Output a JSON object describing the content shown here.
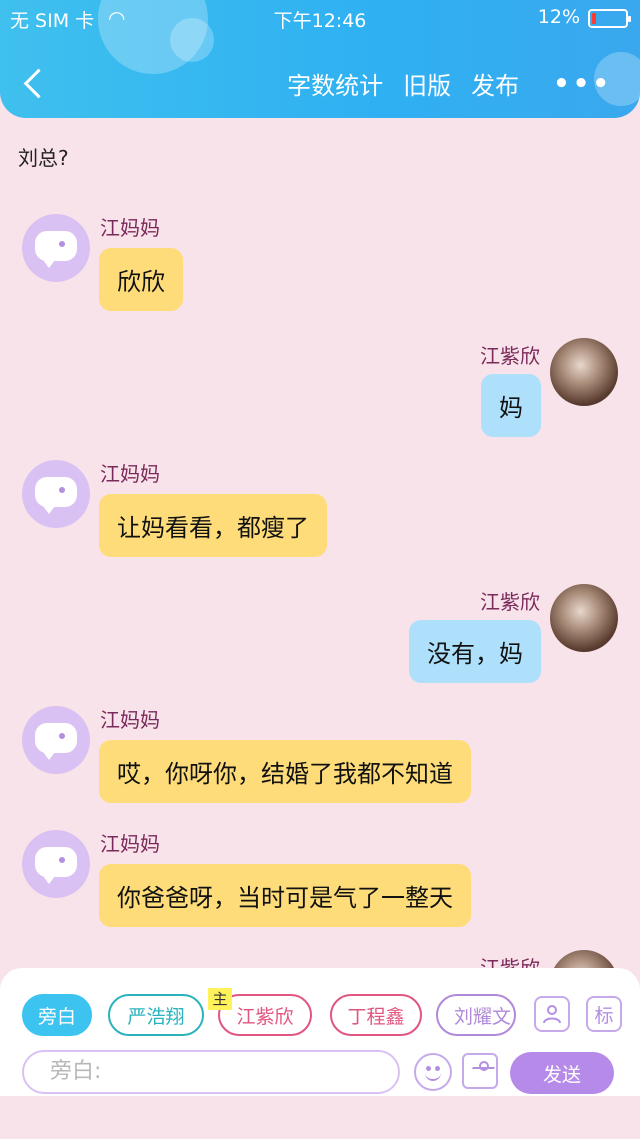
{
  "status": {
    "carrier": "无 SIM 卡",
    "time": "下午12:46",
    "battery_pct": "12%",
    "battery_level": 0.12
  },
  "nav": {
    "word_count": "字数统计",
    "old_version": "旧版",
    "publish": "发布",
    "more": "•••"
  },
  "narration": "刘总?",
  "messages": [
    {
      "side": "left",
      "name": "江妈妈",
      "text": "欣欣"
    },
    {
      "side": "right",
      "name": "江紫欣",
      "text": "妈"
    },
    {
      "side": "left",
      "name": "江妈妈",
      "text": "让妈看看，都瘦了"
    },
    {
      "side": "right",
      "name": "江紫欣",
      "text": "没有，妈"
    },
    {
      "side": "left",
      "name": "江妈妈",
      "text": "哎，你呀你，结婚了我都不知道"
    },
    {
      "side": "left",
      "name": "江妈妈",
      "text": "你爸爸呀，当时可是气了一整天"
    },
    {
      "side": "right",
      "name": "江紫欣",
      "text": ""
    }
  ],
  "chips": [
    {
      "label": "旁白",
      "style": "active"
    },
    {
      "label": "严浩翔",
      "style": "teal"
    },
    {
      "label": "江紫欣",
      "style": "pink",
      "tag": "主"
    },
    {
      "label": "丁程鑫",
      "style": "pink"
    },
    {
      "label": "刘耀文",
      "style": "purple"
    }
  ],
  "tag_button": "标",
  "input": {
    "placeholder": "旁白:"
  },
  "send_label": "发送"
}
